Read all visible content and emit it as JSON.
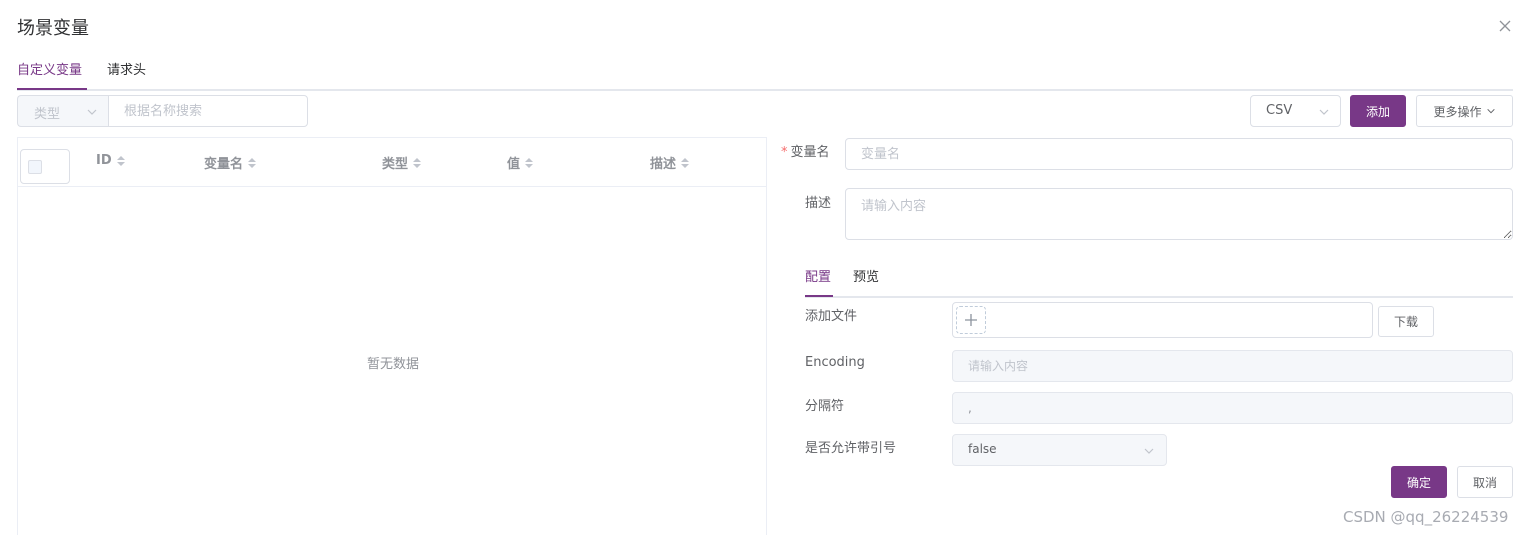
{
  "dialog": {
    "title": "场景变量"
  },
  "tabs": [
    {
      "label": "自定义变量",
      "active": true
    },
    {
      "label": "请求头",
      "active": false
    }
  ],
  "filter": {
    "type_placeholder": "类型",
    "search_placeholder": "根据名称搜索"
  },
  "toolbar": {
    "import_type": "CSV",
    "add_label": "添加",
    "more_label": "更多操作"
  },
  "table": {
    "columns": [
      "ID",
      "变量名",
      "类型",
      "值",
      "描述"
    ],
    "empty_text": "暂无数据"
  },
  "form": {
    "name_label": "变量名",
    "name_placeholder": "变量名",
    "desc_label": "描述",
    "desc_placeholder": "请输入内容",
    "sub_tabs": [
      {
        "label": "配置",
        "active": true
      },
      {
        "label": "预览",
        "active": false
      }
    ],
    "file_label": "添加文件",
    "download_label": "下载",
    "encoding_label": "Encoding",
    "encoding_placeholder": "请输入内容",
    "delimiter_label": "分隔符",
    "delimiter_value": ",",
    "quote_label": "是否允许带引号",
    "quote_value": "false",
    "confirm_label": "确定",
    "cancel_label": "取消"
  },
  "watermark": "CSDN @qq_26224539",
  "colors": {
    "accent": "#783887",
    "required": "#f56c6c",
    "border": "#dcdfe6"
  }
}
